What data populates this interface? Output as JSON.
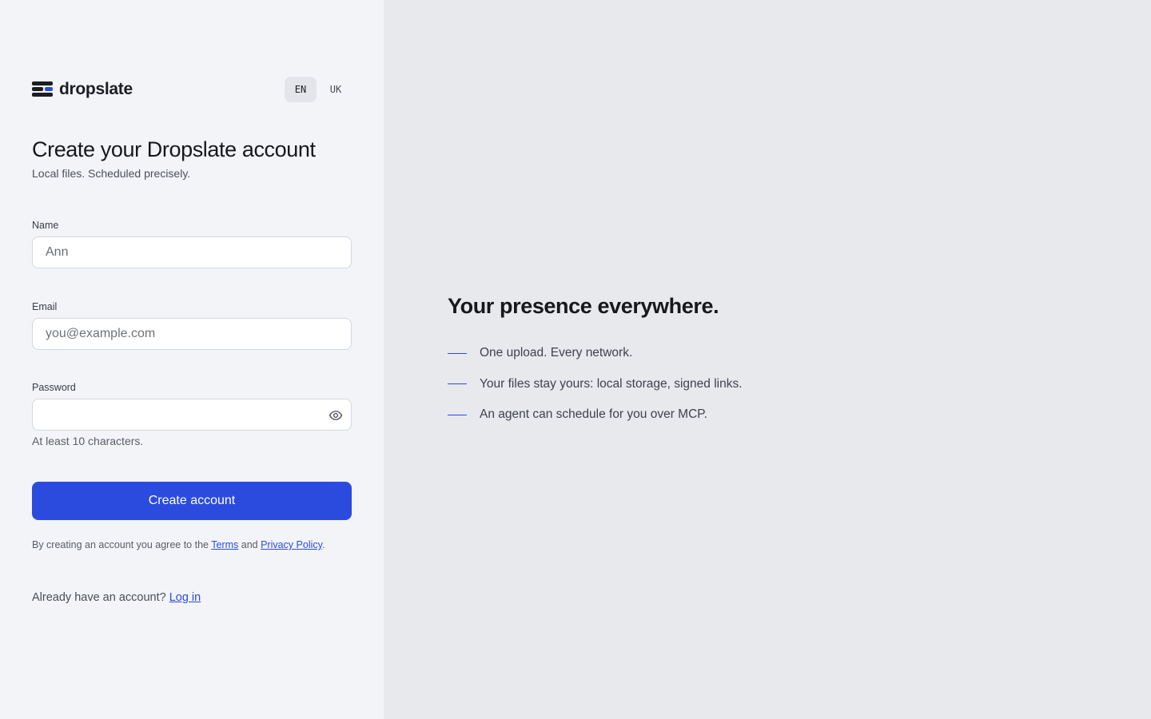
{
  "brand": {
    "name": "dropslate",
    "icon": "stack-logo-icon"
  },
  "languages": [
    {
      "code": "EN",
      "active": true
    },
    {
      "code": "UK",
      "active": false
    }
  ],
  "form": {
    "title": "Create your Dropslate account",
    "subtitle": "Local files. Scheduled precisely.",
    "name": {
      "label": "Name",
      "value": "Ann"
    },
    "email": {
      "label": "Email",
      "placeholder": "you@example.com"
    },
    "password": {
      "label": "Password",
      "value": "",
      "hint": "At least 10 characters.",
      "toggle_icon": "eye-icon"
    },
    "submit_label": "Create account",
    "legal": {
      "prefix": "By creating an account you agree to the ",
      "terms": "Terms",
      "and": " and ",
      "privacy": "Privacy Policy",
      "suffix": "."
    },
    "login": {
      "prompt": "Already have an account? ",
      "link": "Log in"
    }
  },
  "promo": {
    "title": "Your presence everywhere.",
    "features": [
      "One upload. Every network.",
      "Your files stay yours: local storage, signed links.",
      "An agent can schedule for you over MCP."
    ]
  },
  "colors": {
    "accent": "#2b4bdf",
    "left_bg": "#f2f4f8",
    "right_bg": "#e8e9ed"
  }
}
